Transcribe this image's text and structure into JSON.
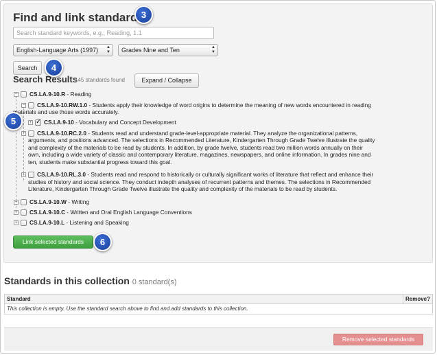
{
  "find": {
    "title": "Find and link standards",
    "search_placeholder": "Search standard keywords, e.g., Reading, 1.1",
    "subject_select": "English-Language Arts (1997)",
    "grade_select": "Grades Nine and Ten",
    "search_label": "Search"
  },
  "results": {
    "title": "Search Results",
    "count": "145 standards found",
    "expand_label": "Expand / Collapse",
    "tree": [
      {
        "code": "CS.LA.9-10.R",
        "text": " - Reading"
      },
      {
        "code": "CS.LA.9-10.RW.1.0",
        "text": " - Students apply their knowledge of word origins to determine the meaning of new words encountered in reading",
        "text2": "materials and use those words accurately."
      },
      {
        "code": "CS.LA.9-10",
        "text": " - Vocabulary and Concept Development"
      },
      {
        "code": "CS.LA.9-10.RC.2.0",
        "text": " - Students read and understand grade-level-appropriate material. They analyze the organizational patterns,",
        "lines": [
          "arguments, and positions advanced. The selections in Recommended Literature, Kindergarten Through Grade Twelve illustrate the quality",
          "and complexity of the materials to be read by students. In addition, by grade twelve, students read two million words annually on their",
          "own, including a wide variety of classic and contemporary literature, magazines, newspapers, and online information. In grades nine and",
          "ten, students make substantial progress toward this goal."
        ]
      },
      {
        "code": "CS.LA.9-10.RL.3.0",
        "text": " - Students read and respond to historically or culturally significant works of literature that reflect and enhance their",
        "lines": [
          "studies of history and social science. They conduct indepth analyses of recurrent patterns and themes. The selections in Recommended",
          "Literature, Kindergarten Through Grade Twelve illustrate the quality and complexity of the materials to be read by students."
        ]
      },
      {
        "code": "CS.LA.9-10.W",
        "text": " - Writing"
      },
      {
        "code": "CS.LA.9-10.C",
        "text": " - Written and Oral English Language Conventions"
      },
      {
        "code": "CS.LA.9-10.L",
        "text": " - Listening and Speaking"
      }
    ],
    "link_label": "Link selected standards"
  },
  "callouts": [
    "3",
    "4",
    "5",
    "6"
  ],
  "collection": {
    "title": "Standards in this collection",
    "count": "0 standard(s)",
    "col_standard": "Standard",
    "col_remove": "Remove?",
    "empty_text": "This collection is empty. Use the standard search above to find and add standards to this collection.",
    "remove_label": "Remove selected standards"
  },
  "colors": {
    "callout": "#1f4fb8",
    "link_button": "#4aad4a",
    "remove_button": "#e59090"
  }
}
